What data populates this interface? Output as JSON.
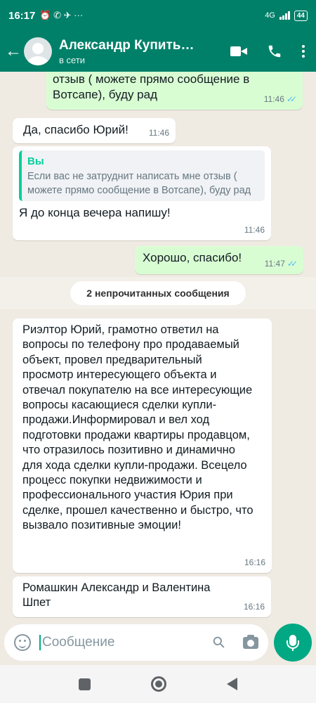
{
  "status_bar": {
    "time": "16:17",
    "icons_left": "⏰ ✆ ✈ ···",
    "network": "4G",
    "battery": "44"
  },
  "header": {
    "contact_name": "Александр Купить…",
    "presence": "в сети"
  },
  "messages": [
    {
      "direction": "outgoing",
      "text": "отзыв ( можете прямо сообщение в Вотсапе), буду рад",
      "time": "11:46",
      "read": true
    },
    {
      "direction": "incoming",
      "text": "Да, спасибо Юрий!",
      "time": "11:46"
    },
    {
      "direction": "incoming",
      "quote_author": "Вы",
      "quote_text": "Если вас не затруднит написать мне отзыв ( можете прямо сообщение в Вотсапе), буду рад",
      "text": "Я до конца вечера напишу!",
      "time": "11:46"
    },
    {
      "direction": "outgoing",
      "text": "Хорошо, спасибо!",
      "time": "11:47",
      "read": true
    },
    {
      "direction": "incoming",
      "text": "Риэлтор Юрий, грамотно ответил на вопросы по телефону про продаваемый объект, провел предварительный просмотр интересующего объекта и отвечал покупателю  на все интересующие вопросы касающиеся сделки купли-продажи.Информировал и вел ход подготовки продажи квартиры продавцом, что отразилось позитивно и динамично для хода сделки купли-продажи. Всецело процесс покупки недвижимости и профессионального участия Юрия при сделке,  прошел качественно и быстро, что вызвало позитивные эмоции!",
      "time": "16:16"
    },
    {
      "direction": "incoming",
      "text": "Ромашкин Александр и Валентина Шпет",
      "time": "16:16"
    }
  ],
  "unread_divider": "2 непрочитанных сообщения",
  "input": {
    "placeholder": "Сообщение"
  },
  "colors": {
    "header": "#008069",
    "outgoing_bubble": "#d9fdd3",
    "incoming_bubble": "#ffffff",
    "chat_background": "#efeae2",
    "read_ticks": "#53bdeb",
    "accent": "#00a884"
  }
}
